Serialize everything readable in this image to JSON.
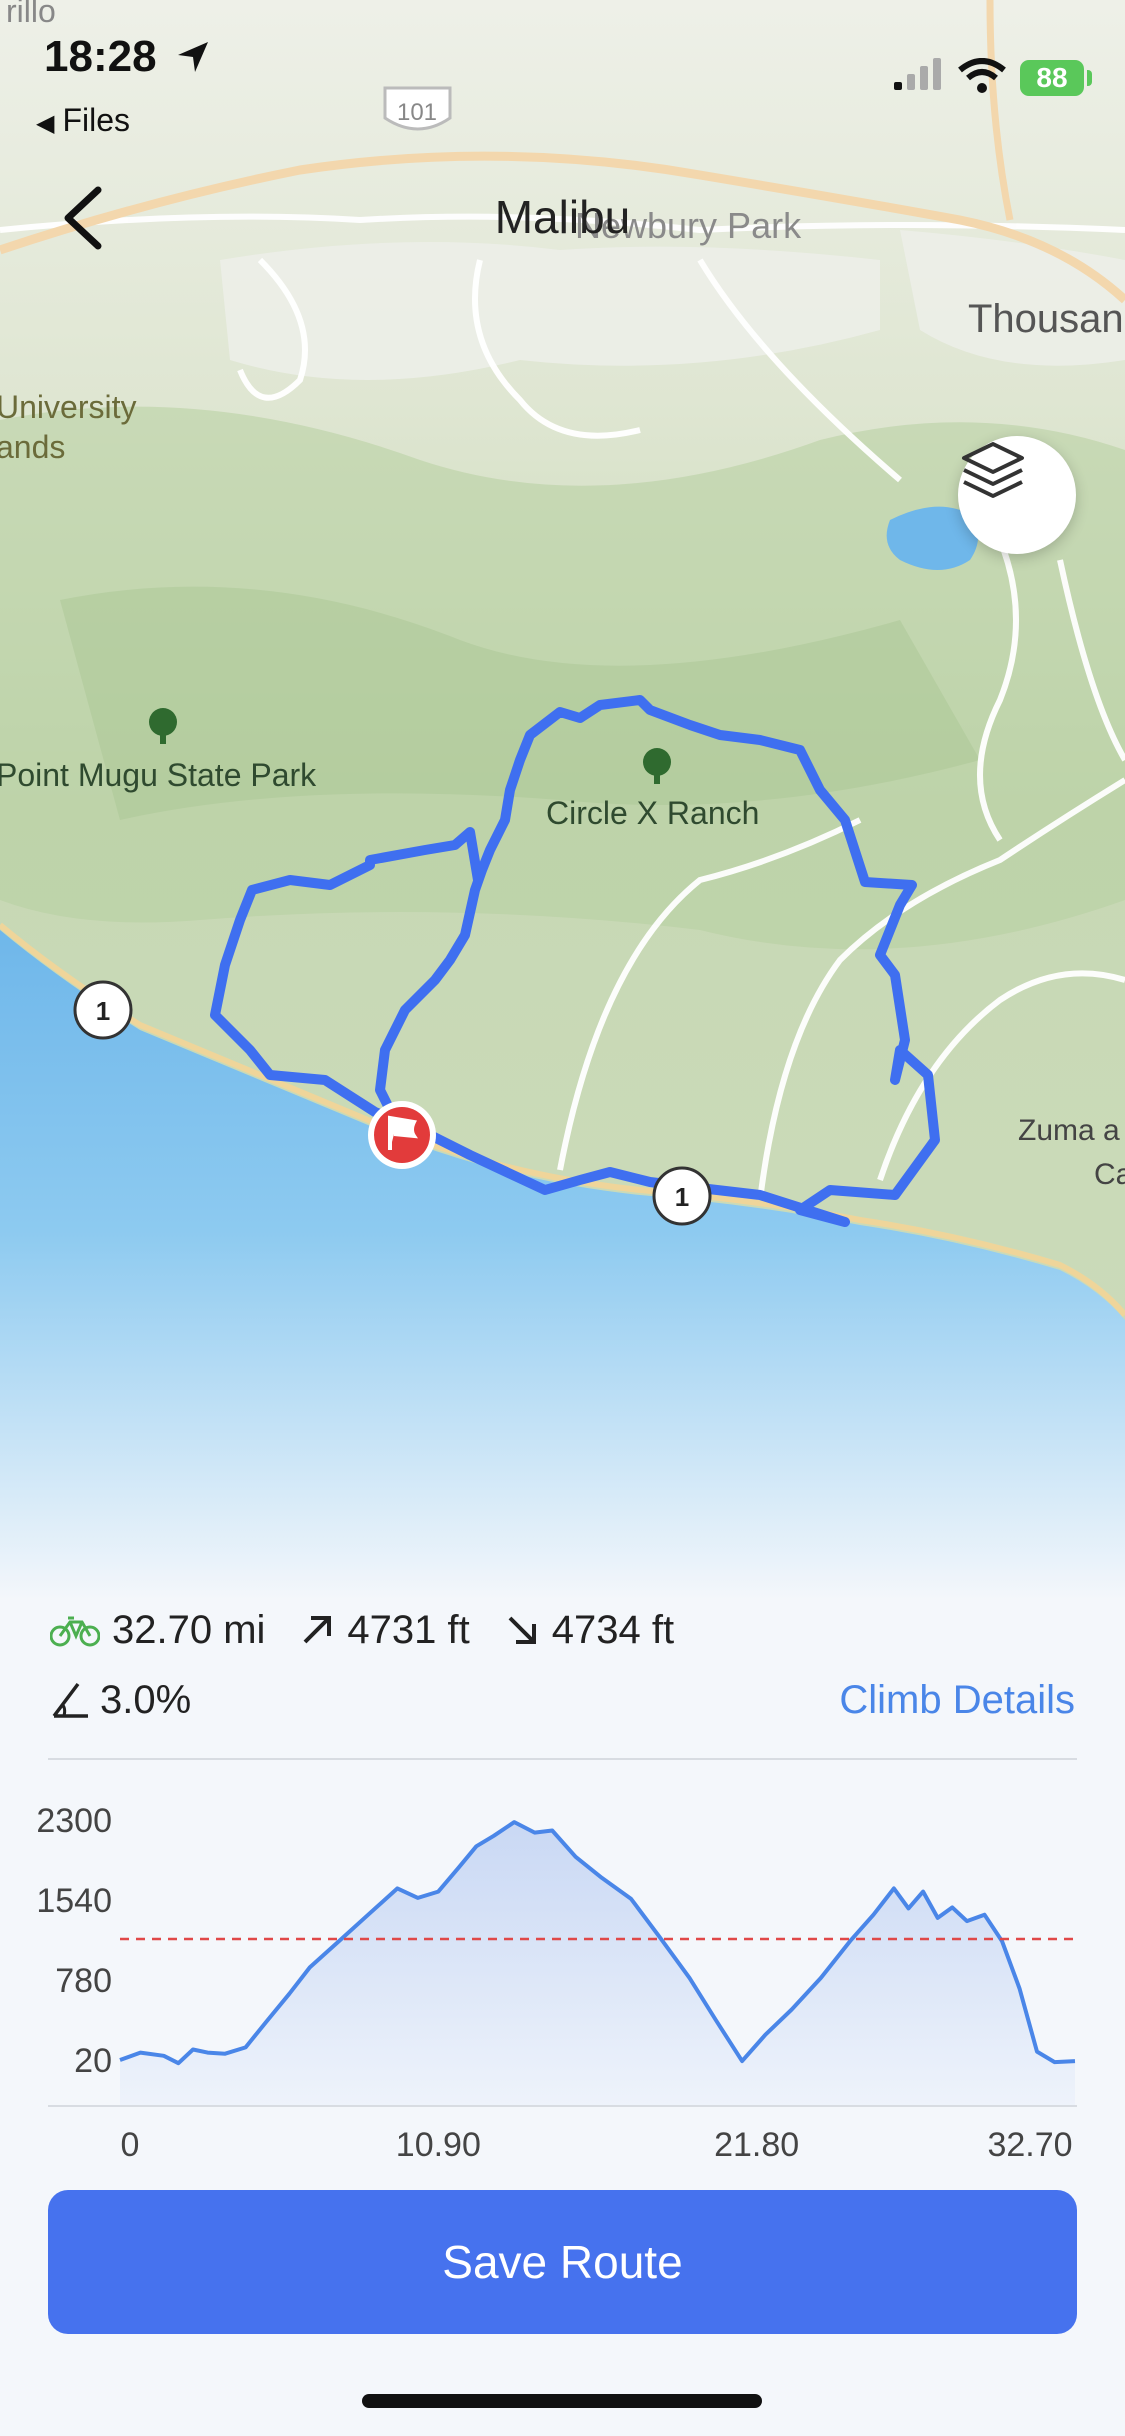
{
  "status_bar": {
    "time": "18:28",
    "back_app": "Files",
    "battery": "88"
  },
  "nav": {
    "title": "Malibu"
  },
  "map": {
    "place_labels": {
      "newbury_park": "Newbury Park",
      "thousand": "Thousan",
      "university_lands_1": "University",
      "university_lands_2": "ands",
      "point_mugu": "Point Mugu State Park",
      "circle_x": "Circle X Ranch",
      "zuma_1": "Zuma a",
      "zuma_2": "Ca",
      "top_left": "rillo"
    },
    "road_shields": {
      "hwy101": "101",
      "hwy1_left": "1",
      "hwy1_right": "1"
    },
    "route_color": "#3f6ff0"
  },
  "stats": {
    "distance": "32.70 mi",
    "ascent": "4731 ft",
    "descent": "4734 ft",
    "grade": "3.0%",
    "climb_details_label": "Climb Details"
  },
  "chart_data": {
    "type": "area",
    "title": "",
    "xlabel": "",
    "ylabel": "",
    "x_ticks": [
      "0",
      "10.90",
      "21.80",
      "32.70"
    ],
    "y_ticks": [
      "2300",
      "1540",
      "780",
      "20"
    ],
    "xlim": [
      0,
      32.7
    ],
    "ylim": [
      20,
      2300
    ],
    "reference_line": 1170,
    "series": [
      {
        "x": [
          0,
          0.7,
          1.5,
          2.0,
          2.5,
          3.0,
          3.6,
          4.3,
          5.0,
          5.8,
          6.5,
          7.5,
          8.5,
          9.5,
          10.2,
          10.9,
          11.6,
          12.2,
          12.8,
          13.5,
          14.2,
          14.8,
          15.6,
          16.5,
          17.5,
          18.5,
          19.5,
          20.4,
          21.3,
          22.1,
          23.0,
          24.0,
          25.0,
          25.8,
          26.5,
          27.0,
          27.5,
          28.0,
          28.5,
          29.0,
          29.6,
          30.2,
          30.8,
          31.4,
          32.0,
          32.7
        ],
        "y": [
          20,
          90,
          60,
          -10,
          120,
          90,
          80,
          140,
          380,
          650,
          900,
          1150,
          1400,
          1650,
          1560,
          1620,
          1850,
          2050,
          2150,
          2280,
          2180,
          2200,
          1950,
          1750,
          1550,
          1180,
          800,
          400,
          10,
          260,
          500,
          800,
          1150,
          1400,
          1650,
          1460,
          1620,
          1370,
          1470,
          1340,
          1400,
          1150,
          700,
          100,
          0,
          10
        ]
      }
    ]
  },
  "actions": {
    "save_route": "Save Route"
  }
}
